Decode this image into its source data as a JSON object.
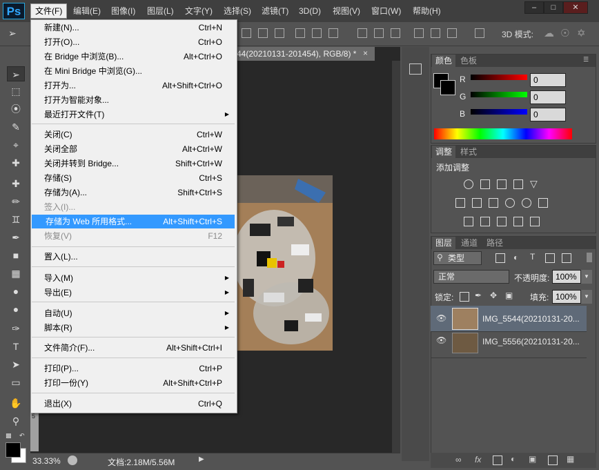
{
  "app": {
    "logo": "Ps"
  },
  "menubar": [
    "文件(F)",
    "编辑(E)",
    "图像(I)",
    "图层(L)",
    "文字(Y)",
    "选择(S)",
    "滤镜(T)",
    "3D(D)",
    "视图(V)",
    "窗口(W)",
    "帮助(H)"
  ],
  "window_buttons": [
    "minimize-icon",
    "maximize-icon",
    "close-icon"
  ],
  "options_bar": {
    "mode_3d": "3D 模式:"
  },
  "document": {
    "tab_title": "44(20210131-201454), RGB/8) *",
    "close": "×"
  },
  "ruler_marks": [
    "5"
  ],
  "file_menu": {
    "items": [
      {
        "label": "新建(N)...",
        "shortcut": "Ctrl+N"
      },
      {
        "label": "打开(O)...",
        "shortcut": "Ctrl+O"
      },
      {
        "label": "在 Bridge 中浏览(B)...",
        "shortcut": "Alt+Ctrl+O"
      },
      {
        "label": "在 Mini Bridge 中浏览(G)...",
        "shortcut": ""
      },
      {
        "label": "打开为...",
        "shortcut": "Alt+Shift+Ctrl+O"
      },
      {
        "label": "打开为智能对象...",
        "shortcut": ""
      },
      {
        "label": "最近打开文件(T)",
        "shortcut": "",
        "submenu": true
      },
      {
        "label": "关闭(C)",
        "shortcut": "Ctrl+W"
      },
      {
        "label": "关闭全部",
        "shortcut": "Alt+Ctrl+W"
      },
      {
        "label": "关闭并转到 Bridge...",
        "shortcut": "Shift+Ctrl+W"
      },
      {
        "label": "存储(S)",
        "shortcut": "Ctrl+S"
      },
      {
        "label": "存储为(A)...",
        "shortcut": "Shift+Ctrl+S"
      },
      {
        "label": "签入(I)...",
        "shortcut": "",
        "disabled": true
      },
      {
        "label": "存储为 Web 所用格式...",
        "shortcut": "Alt+Shift+Ctrl+S",
        "highlighted": true
      },
      {
        "label": "恢复(V)",
        "shortcut": "F12",
        "disabled": true
      },
      {
        "label": "置入(L)...",
        "shortcut": ""
      },
      {
        "label": "导入(M)",
        "shortcut": "",
        "submenu": true
      },
      {
        "label": "导出(E)",
        "shortcut": "",
        "submenu": true
      },
      {
        "label": "自动(U)",
        "shortcut": "",
        "submenu": true
      },
      {
        "label": "脚本(R)",
        "shortcut": "",
        "submenu": true
      },
      {
        "label": "文件简介(F)...",
        "shortcut": "Alt+Shift+Ctrl+I"
      },
      {
        "label": "打印(P)...",
        "shortcut": "Ctrl+P"
      },
      {
        "label": "打印一份(Y)",
        "shortcut": "Alt+Shift+Ctrl+P"
      },
      {
        "label": "退出(X)",
        "shortcut": "Ctrl+Q"
      }
    ]
  },
  "status_bar": {
    "zoom": "33.33%",
    "doc_info": "文档:2.18M/5.56M"
  },
  "color_panel": {
    "tabs": [
      "颜色",
      "色板"
    ],
    "channels": [
      {
        "name": "R",
        "value": "0",
        "color": "#ff0000"
      },
      {
        "name": "G",
        "value": "0",
        "color": "#00ff00"
      },
      {
        "name": "B",
        "value": "0",
        "color": "#0000ff"
      }
    ]
  },
  "adjustments_panel": {
    "tabs": [
      "调整",
      "样式"
    ],
    "title": "添加调整"
  },
  "layers_panel": {
    "tabs": [
      "图层",
      "通道",
      "路径"
    ],
    "filter_kind": "类型",
    "blend_mode": "正常",
    "opacity_label": "不透明度:",
    "opacity": "100%",
    "lock_label": "锁定:",
    "fill_label": "填充:",
    "fill": "100%",
    "layers": [
      {
        "name": "IMG_5544(20210131-20...",
        "selected": true
      },
      {
        "name": "IMG_5556(20210131-20...",
        "selected": false
      }
    ]
  },
  "colors": {
    "highlight": "#3399ff",
    "accent": "#31a8ff"
  }
}
